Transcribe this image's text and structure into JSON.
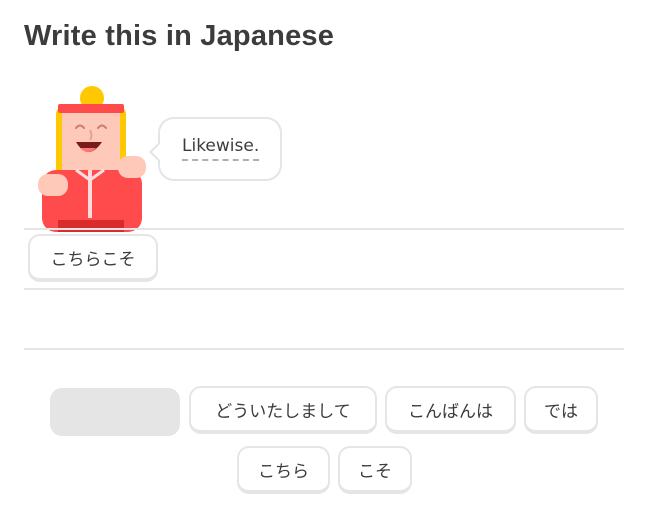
{
  "prompt": {
    "title": "Write this in Japanese"
  },
  "speech": {
    "text": "Likewise."
  },
  "answer": {
    "selected_tiles": [
      "こちらこそ"
    ]
  },
  "word_bank": {
    "tiles": [
      "どういたしまして",
      "こんばんは",
      "では",
      "こちら",
      "こそ"
    ]
  },
  "colors": {
    "text": "#3c3c3c",
    "border": "#e5e5e5",
    "placeholder": "#e5e5e5",
    "character_shirt": "#ff4b4b",
    "character_hair": "#ffc800",
    "character_skin": "#ffc9b9"
  },
  "icons": {
    "character": "lily-character-illustration"
  }
}
